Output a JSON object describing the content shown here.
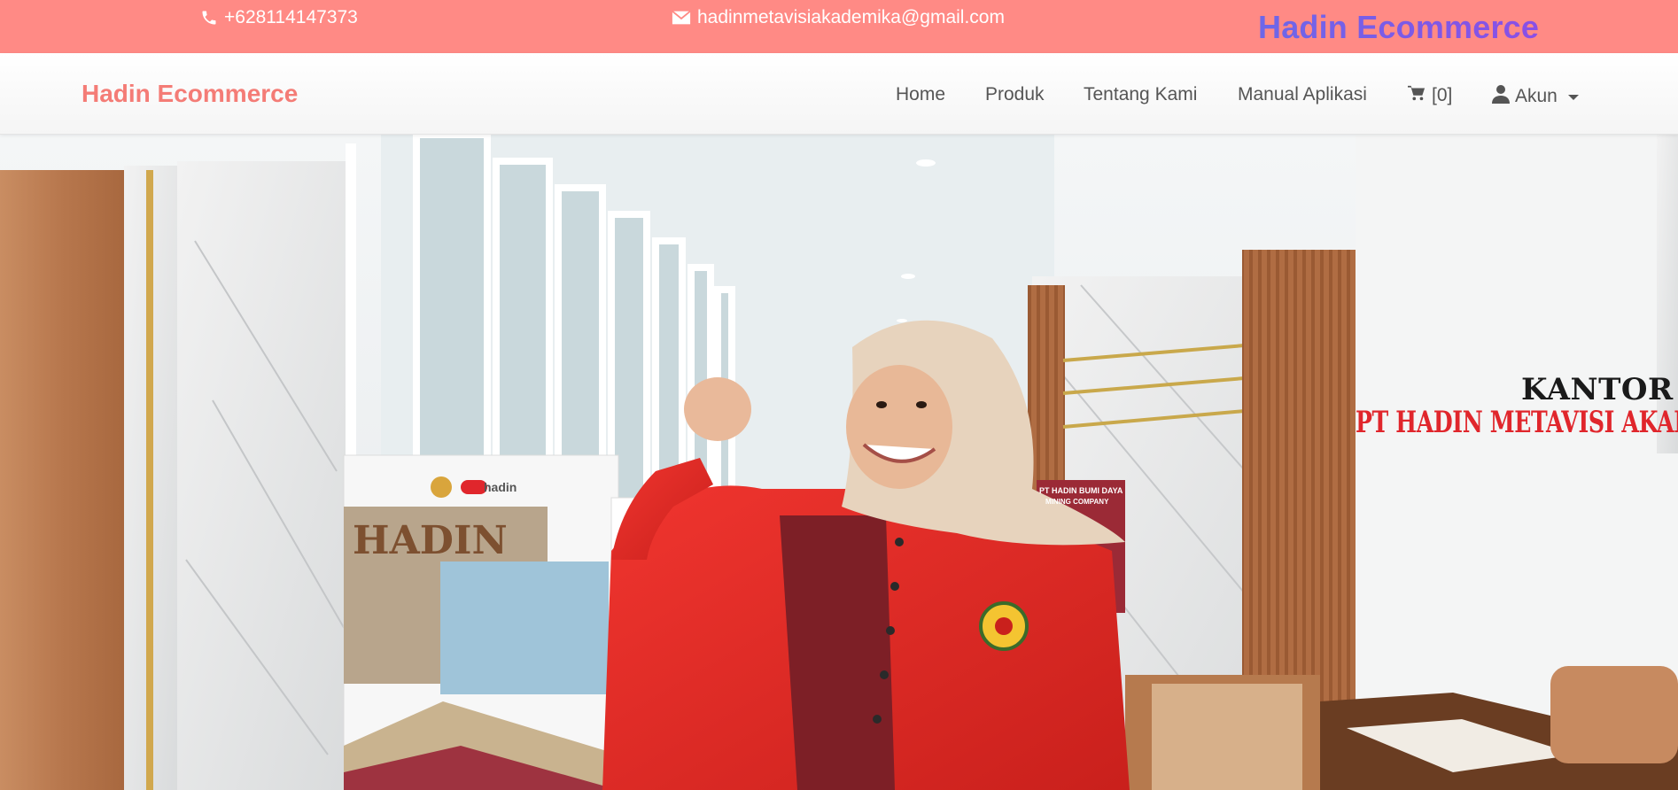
{
  "topbar": {
    "phone": "+628114147373",
    "email": "hadinmetavisiakademika@gmail.com",
    "brand": "Hadin Ecommerce",
    "background_color": "#ff8a85",
    "phone_icon": "phone-icon",
    "email_icon": "envelope-icon"
  },
  "navbar": {
    "brand": "Hadin Ecommerce",
    "brand_color": "#f47c76",
    "links": {
      "home": "Home",
      "produk": "Produk",
      "tentang": "Tentang Kami",
      "manual": "Manual Aplikasi"
    },
    "cart": {
      "icon": "shopping-cart-icon",
      "label": "[0]"
    },
    "account": {
      "icon": "user-icon",
      "label": "Akun",
      "dropdown_icon": "caret-down-icon"
    }
  },
  "hero": {
    "sign_top": "KANTOR",
    "sign_bottom": "PT HADIN METAVISI AKADEMIKA",
    "banner_logo": "hadin",
    "banner_title": "HADIN",
    "banner_small": "PT HADIN BUMI DAYA",
    "banner_small_sub": "MINING COMPANY"
  }
}
